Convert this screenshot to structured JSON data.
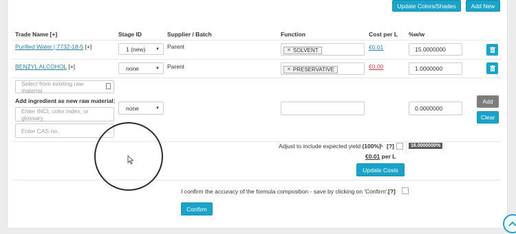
{
  "toolbar": {
    "update_colors_label": "Update Colors/Shades",
    "add_new_label": "Add New"
  },
  "table": {
    "headers": {
      "trade_name": "Trade Name [+]",
      "stage_id": "Stage ID",
      "supplier": "Supplier / Batch",
      "function": "Function",
      "cost": "Cost per L",
      "wwpct": "%w/w"
    },
    "rows": [
      {
        "trade_name": "Purified Water | 7732-18-5",
        "plus": "[+]",
        "stage": "1 (new)",
        "supplier": "Parent",
        "function_tag": "SOLVENT",
        "cost": "€0.01",
        "cost_color": "#2a7fa8",
        "wwpct": "15.0000000"
      },
      {
        "trade_name": "BENZYL ALCOHOL",
        "plus": "[+]",
        "stage": "none",
        "supplier": "Parent",
        "function_tag": "PRESERVATIVE",
        "cost": "€0.00",
        "cost_color": "#d04040",
        "wwpct": "1.0000000"
      }
    ]
  },
  "add_ingredient": {
    "select_existing_placeholder": "Select from existing raw material",
    "label": "Add ingredient as new raw material:",
    "inci_placeholder": "Enter INCI, color index, or glossary",
    "cas_placeholder": "Enter CAS no.",
    "stage": "none",
    "wwpct": "0.0000000",
    "add_label": "Add",
    "clear_label": "Clear"
  },
  "totals": {
    "adjust_label": "Adjust to include expected yield",
    "adjust_pct": "(100%)",
    "help": "[?]",
    "total_pct": "16.0000000%",
    "cost_value": "€0.01",
    "cost_unit": "per L",
    "update_costs_label": "Update Costs"
  },
  "confirm": {
    "text": "I confirm the accuracy of the formula composition - save by clicking on 'Confirm'.",
    "help": "[?]",
    "button_label": "Confirm"
  },
  "colors": {
    "accent": "#1aa3c8",
    "grey_button": "#7d7d7d",
    "badge": "#5a5a5a"
  }
}
